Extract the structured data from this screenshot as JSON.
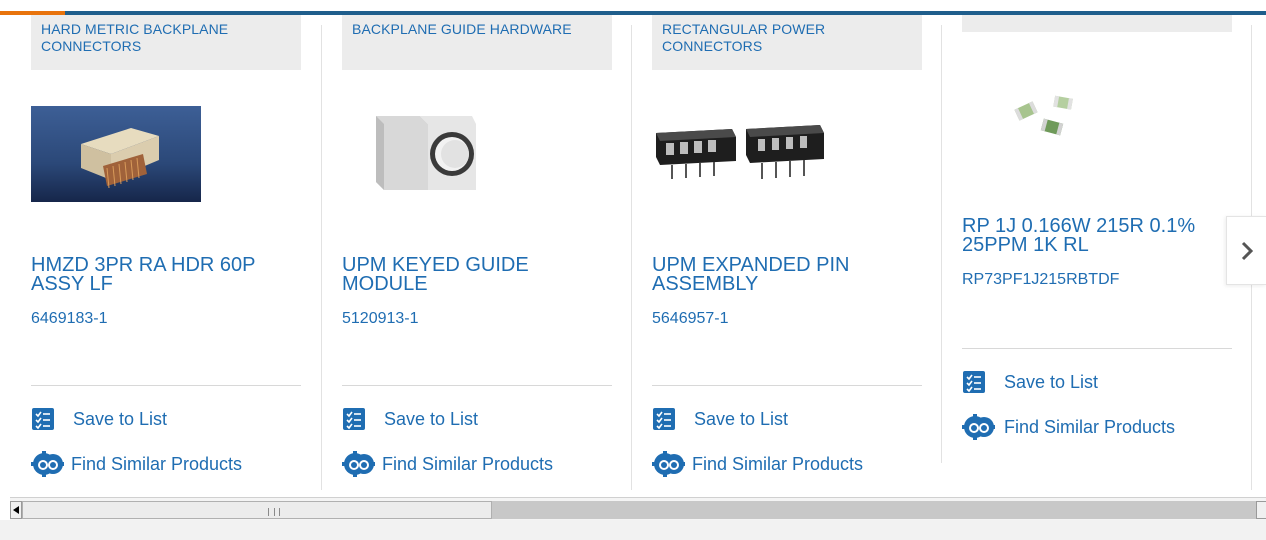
{
  "carousel": {
    "cards": [
      {
        "category": "HARD METRIC BACKPLANE CONNECTORS",
        "title": "HMZD 3PR RA HDR 60P ASSY LF",
        "part_number": "6469183-1",
        "image_icon": "backplane-connector-photo",
        "save_label": "Save to List",
        "similar_label": "Find Similar Products"
      },
      {
        "category": "BACKPLANE GUIDE HARDWARE",
        "title": "UPM KEYED GUIDE MODULE",
        "part_number": "5120913-1",
        "image_icon": "guide-module-photo",
        "save_label": "Save to List",
        "similar_label": "Find Similar Products"
      },
      {
        "category": "RECTANGULAR POWER CONNECTORS",
        "title": "UPM EXPANDED PIN ASSEMBLY",
        "part_number": "5646957-1",
        "image_icon": "pin-assembly-photo",
        "save_label": "Save to List",
        "similar_label": "Find Similar Products"
      },
      {
        "category": "",
        "title": "RP 1J 0.166W 215R 0.1% 25PPM 1K RL",
        "part_number": "RP73PF1J215RBTDF",
        "image_icon": "chip-resistor-photo",
        "save_label": "Save to List",
        "similar_label": "Find Similar Products"
      }
    ],
    "next_icon": "chevron-right-icon"
  },
  "colors": {
    "accent": "#1f6db2",
    "top_bar": "#1f5e8c",
    "top_accent": "#e8730c",
    "category_bg": "#ececec"
  }
}
